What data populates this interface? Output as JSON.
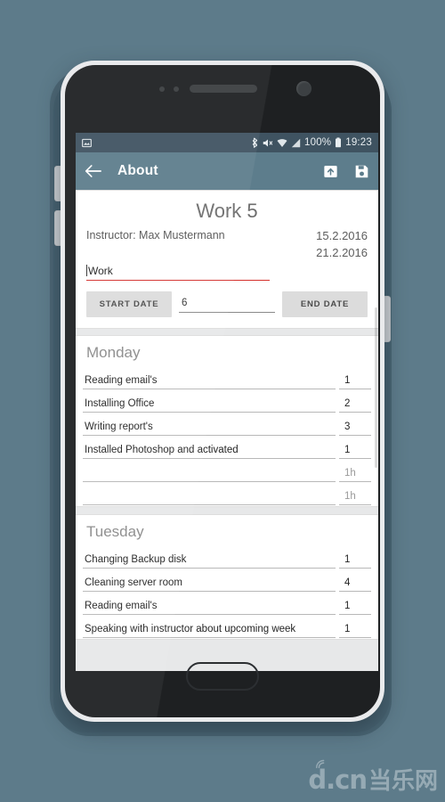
{
  "device": {
    "home_button": "home-button",
    "camera": "front-camera",
    "speaker": "earpiece-speaker"
  },
  "statusbar": {
    "notification_icon": "screenshot-image-icon",
    "icons": [
      "bluetooth-icon",
      "volume-muted-icon",
      "wifi-icon",
      "cellular-signal-icon"
    ],
    "battery_percent": "100%",
    "battery_icon": "battery-full-icon",
    "time": "19:23"
  },
  "appbar": {
    "back_icon": "back-arrow-icon",
    "title": "About",
    "export_icon": "export-upload-icon",
    "save_icon": "save-floppy-icon"
  },
  "header_card": {
    "work_title": "Work 5",
    "instructor": "Instructor: Max Mustermann",
    "start_date": "15.2.2016",
    "end_date": "21.2.2016",
    "work_field_value": "Work",
    "work_field_placeholder": "Work",
    "start_date_button": "START DATE",
    "end_date_button": "END DATE",
    "number_field_value": "6",
    "number_field_placeholder": "",
    "error_color": "#d4302c"
  },
  "days": [
    {
      "title": "Monday",
      "tasks": [
        {
          "name": "Reading email's",
          "hours": "1",
          "hours_is_hint": false
        },
        {
          "name": "Installing Office",
          "hours": "2",
          "hours_is_hint": false
        },
        {
          "name": "Writing report's",
          "hours": "3",
          "hours_is_hint": false
        },
        {
          "name": "Installed Photoshop and activated",
          "hours": "1",
          "hours_is_hint": false
        },
        {
          "name": "",
          "hours": "1h",
          "hours_is_hint": true
        },
        {
          "name": "",
          "hours": "1h",
          "hours_is_hint": true
        }
      ]
    },
    {
      "title": "Tuesday",
      "tasks": [
        {
          "name": "Changing Backup disk",
          "hours": "1",
          "hours_is_hint": false
        },
        {
          "name": "Cleaning server room",
          "hours": "4",
          "hours_is_hint": false
        },
        {
          "name": "Reading email's",
          "hours": "1",
          "hours_is_hint": false
        },
        {
          "name": "Speaking with instructor about upcoming week",
          "hours": "1",
          "hours_is_hint": false
        }
      ]
    }
  ],
  "watermark": {
    "latin": "d.cn",
    "chinese": "当乐网",
    "wave_icon": "signal-wave-icon"
  },
  "colors": {
    "background": "#5d7b8a",
    "appbar": "#5d7d8c",
    "statusbar": "#3f5361",
    "card": "#ffffff",
    "content_bg": "#e7e8e9"
  }
}
